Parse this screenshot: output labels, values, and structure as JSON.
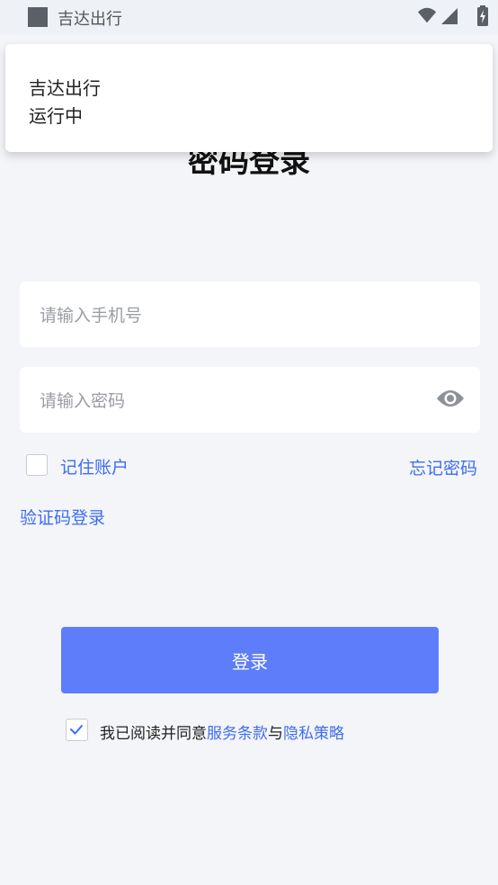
{
  "status_bar": {
    "app_name": "吉达出行"
  },
  "notification": {
    "title": "吉达出行",
    "text": "运行中"
  },
  "page": {
    "title": "密码登录"
  },
  "form": {
    "phone_placeholder": "请输入手机号",
    "password_placeholder": "请输入密码",
    "remember_label": "记住账户",
    "remember_checked": false,
    "forgot_label": "忘记密码",
    "sms_login_label": "验证码登录",
    "login_button": "登录"
  },
  "agreement": {
    "checked": true,
    "prefix": "我已阅读并同意",
    "terms": "服务条款",
    "and": "与",
    "privacy": "隐私策略"
  },
  "colors": {
    "accent": "#3d6df2",
    "button": "#5e7dfb",
    "background": "#f4f5f8"
  }
}
